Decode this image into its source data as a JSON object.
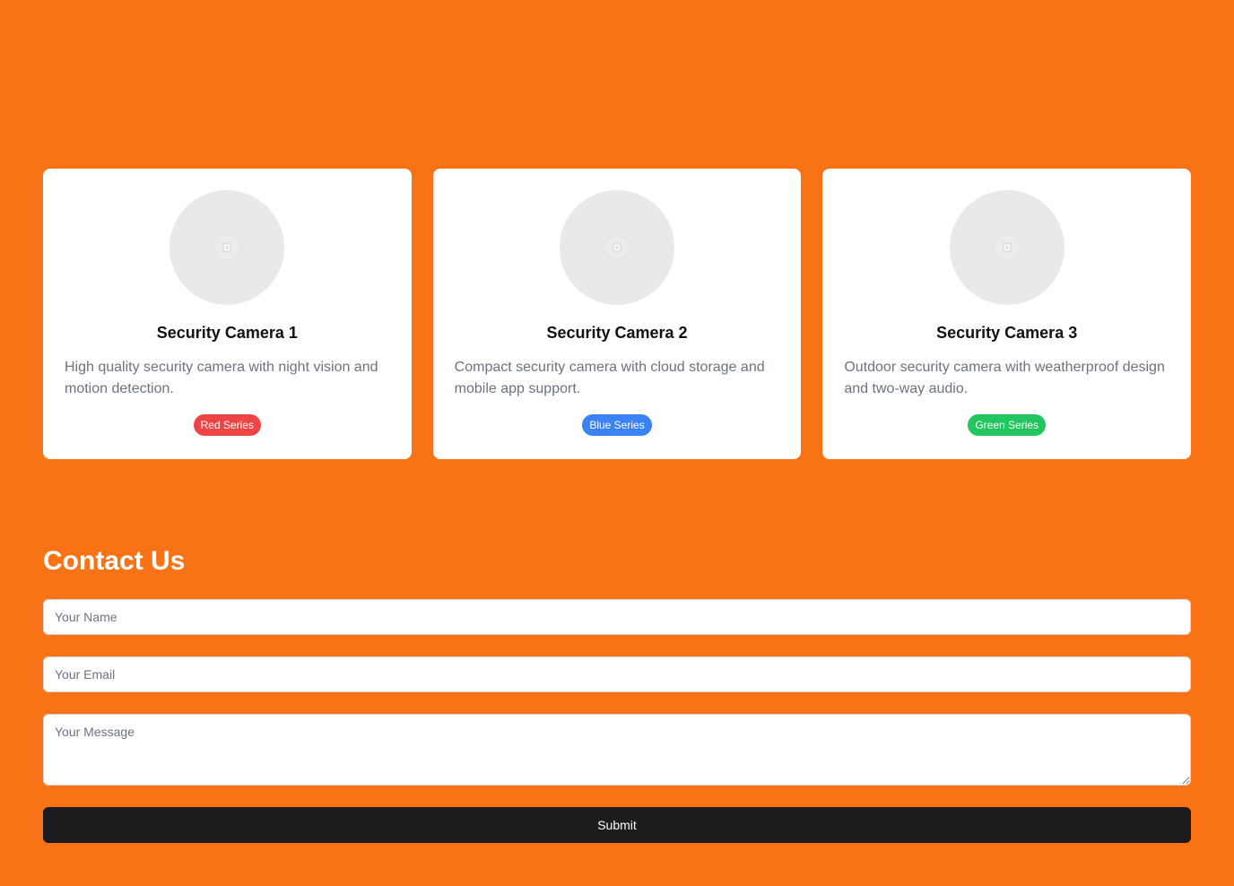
{
  "products": [
    {
      "title": "Security Camera 1",
      "description": "High quality security camera with night vision and motion detection.",
      "badge": "Red Series",
      "badge_color": "#ef4444"
    },
    {
      "title": "Security Camera 2",
      "description": "Compact security camera with cloud storage and mobile app support.",
      "badge": "Blue Series",
      "badge_color": "#3b82f6"
    },
    {
      "title": "Security Camera 3",
      "description": "Outdoor security camera with weatherproof design and two-way audio.",
      "badge": "Green Series",
      "badge_color": "#22c55e"
    }
  ],
  "contact": {
    "title": "Contact Us",
    "name_placeholder": "Your Name",
    "email_placeholder": "Your Email",
    "message_placeholder": "Your Message",
    "submit_label": "Submit"
  },
  "colors": {
    "background": "#f97316",
    "card": "#ffffff",
    "submit_button": "#1c1c1e"
  },
  "icons": {
    "product_image": "image-placeholder-icon"
  }
}
